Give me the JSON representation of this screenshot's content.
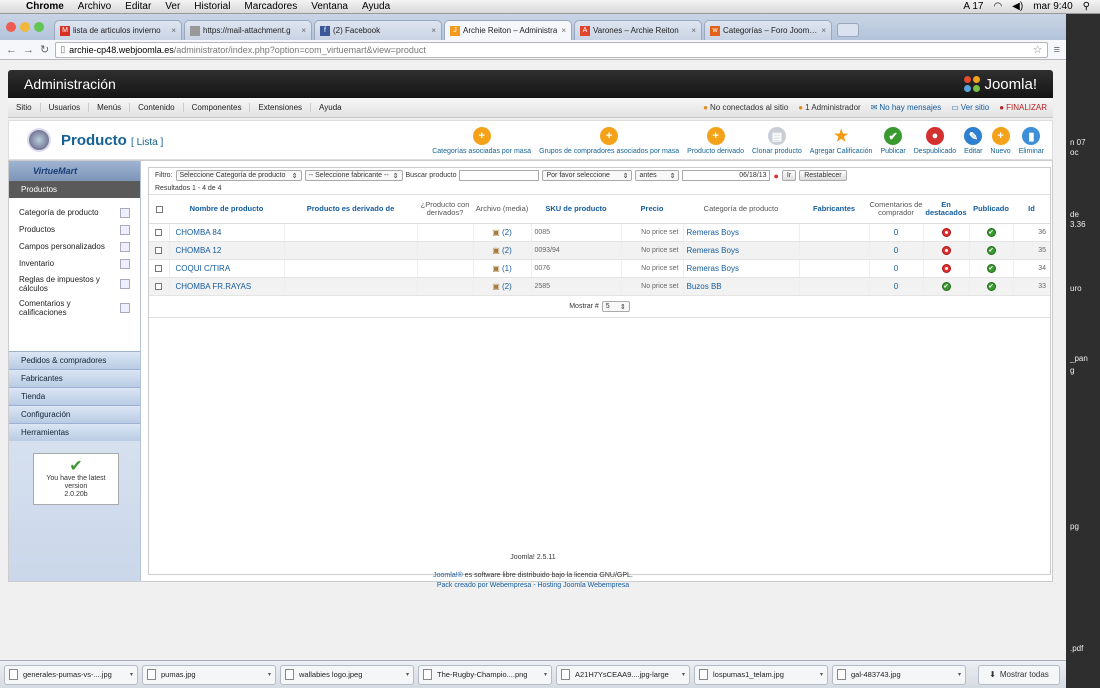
{
  "macbar": {
    "app": "Chrome",
    "menus": [
      "Archivo",
      "Editar",
      "Ver",
      "Historial",
      "Marcadores",
      "Ventana",
      "Ayuda"
    ],
    "status_num": "17",
    "clock": "mar 9:40"
  },
  "browser": {
    "tabs": [
      {
        "title": "lista de articulos invierno",
        "fav_color": "#d93025",
        "fav": "M"
      },
      {
        "title": "https://mail-attachment.g",
        "fav_color": "#999999",
        "fav": ""
      },
      {
        "title": "(2) Facebook",
        "fav_color": "#3b5998",
        "fav": "f"
      },
      {
        "title": "Archie Reiton – Administra",
        "fav_color": "#f39a1e",
        "fav": "J",
        "active": true
      },
      {
        "title": "Varones – Archie Reiton",
        "fav_color": "#e0452b",
        "fav": "A"
      },
      {
        "title": "Categorías – Foro Joomla!",
        "fav_color": "#e2621b",
        "fav": "w"
      }
    ],
    "url_host": "archie-cp48.webjoomla.es",
    "url_path": "/administrator/index.php?option=com_virtuemart&view=product"
  },
  "joomla": {
    "header_title": "Administración",
    "logo_text": "Joomla!",
    "menu": [
      "Sitio",
      "Usuarios",
      "Menús",
      "Contenido",
      "Componentes",
      "Extensiones",
      "Ayuda"
    ],
    "status": {
      "visitors": "No conectados al sitio",
      "admins": "1 Administrador",
      "messages": "No hay mensajes",
      "view_site": "Ver sitio",
      "logout": "FINALIZAR"
    },
    "page_title": "Producto",
    "page_subtitle": "[ Lista ]",
    "toolbar": [
      {
        "label": "Categorías asociadas por masa",
        "icon": "plus-icon",
        "color": "#f5a21b"
      },
      {
        "label": "Grupos de compradores asociados por masa",
        "icon": "plus-icon",
        "color": "#f5a21b"
      },
      {
        "label": "Producto derivado",
        "icon": "plus-icon",
        "color": "#f5a21b"
      },
      {
        "label": "Clonar producto",
        "icon": "copy-icon",
        "color": "#c9ced6"
      },
      {
        "label": "Agregar Calificación",
        "icon": "star-icon",
        "color": "#f39c12"
      },
      {
        "label": "Publicar",
        "icon": "check-icon",
        "color": "#3a9a30"
      },
      {
        "label": "Despublicado",
        "icon": "unpublish-icon",
        "color": "#d33030"
      },
      {
        "label": "Editar",
        "icon": "edit-icon",
        "color": "#2f7fd0"
      },
      {
        "label": "Nuevo",
        "icon": "plus-icon",
        "color": "#f5a21b"
      },
      {
        "label": "Eliminar",
        "icon": "trash-icon",
        "color": "#3d8fd8"
      }
    ]
  },
  "sidebar": {
    "logo": "VirtueMart",
    "active_section": "Productos",
    "items": [
      {
        "label": "Categoría de producto"
      },
      {
        "label": "Productos"
      },
      {
        "label": "Campos personalizados"
      },
      {
        "label": "Inventario"
      },
      {
        "label": "Reglas de impuestos y cálculos"
      },
      {
        "label": "Comentarios y calificaciones"
      }
    ],
    "sections": [
      "Pedidos & compradores",
      "Fabricantes",
      "Tienda",
      "Configuración",
      "Herramientas"
    ],
    "version_line1": "You have the latest",
    "version_line2": "version",
    "version_line3": "2.0.20b"
  },
  "filter": {
    "label": "Filtro:",
    "category_select": "Seleccione Categoría de producto",
    "manufacturer_select": "-- Seleccione fabricante --",
    "search_label": "Buscar producto",
    "search_value": "",
    "date_type_select": "Por favor seleccione",
    "date_op_select": "antes",
    "date_value": "06/18/13",
    "go_button": "Ir",
    "reset_button": "Restablecer",
    "results": "Resultados 1 - 4 de 4"
  },
  "table": {
    "headers": {
      "name": "Nombre de producto",
      "parent": "Producto es derivado de",
      "children": "¿Producto con derivados?",
      "media": "Archivo (media)",
      "sku": "SKU de producto",
      "price": "Precio",
      "category": "Categoría de producto",
      "manufacturer": "Fabricantes",
      "reviews": "Comentarios de comprador",
      "featured": "En destacados",
      "published": "Publicado",
      "id": "Id"
    },
    "rows": [
      {
        "name": "CHOMBA 84",
        "media": "(2)",
        "sku": "0085",
        "price": "No price set",
        "category": "Remeras Boys",
        "reviews": "0",
        "featured": "red",
        "published": "green",
        "id": "36"
      },
      {
        "name": "CHOMBA 12",
        "media": "(2)",
        "sku": "0093/94",
        "price": "No price set",
        "category": "Remeras Boys",
        "reviews": "0",
        "featured": "red",
        "published": "green",
        "id": "35"
      },
      {
        "name": "COQUI C/TIRA",
        "media": "(1)",
        "sku": "0076",
        "price": "No price set",
        "category": "Remeras Boys",
        "reviews": "0",
        "featured": "red",
        "published": "green",
        "id": "34"
      },
      {
        "name": "CHOMBA FR.RAYAS",
        "media": "(2)",
        "sku": "2585",
        "price": "No price set",
        "category": "Buzos BB",
        "reviews": "0",
        "featured": "green",
        "published": "green",
        "id": "33"
      }
    ],
    "pager_label": "Mostrar #",
    "pager_value": "5"
  },
  "footer": {
    "version": "Joomla! 2.5.11",
    "license_link": "Joomla!®",
    "license_text": "es software libre distribuido bajo la licencia GNU/GPL.",
    "pack": "Pack creado por Webempresa - Hosting Joomla Webempresa"
  },
  "downloads": {
    "items": [
      "generales-pumas-vs-....jpg",
      "pumas.jpg",
      "wallabies logo.jpeg",
      "The-Rugby-Champio....png",
      "A21H7YsCEAA9....jpg-large",
      "lospumas1_telam.jpg",
      "gal-483743.jpg"
    ],
    "show_all": "Mostrar todas"
  },
  "desktop_labels": [
    "n 07",
    "oc",
    "de",
    "3.36",
    "uro",
    "_pan",
    "g",
    "pg",
    ".pdf"
  ]
}
